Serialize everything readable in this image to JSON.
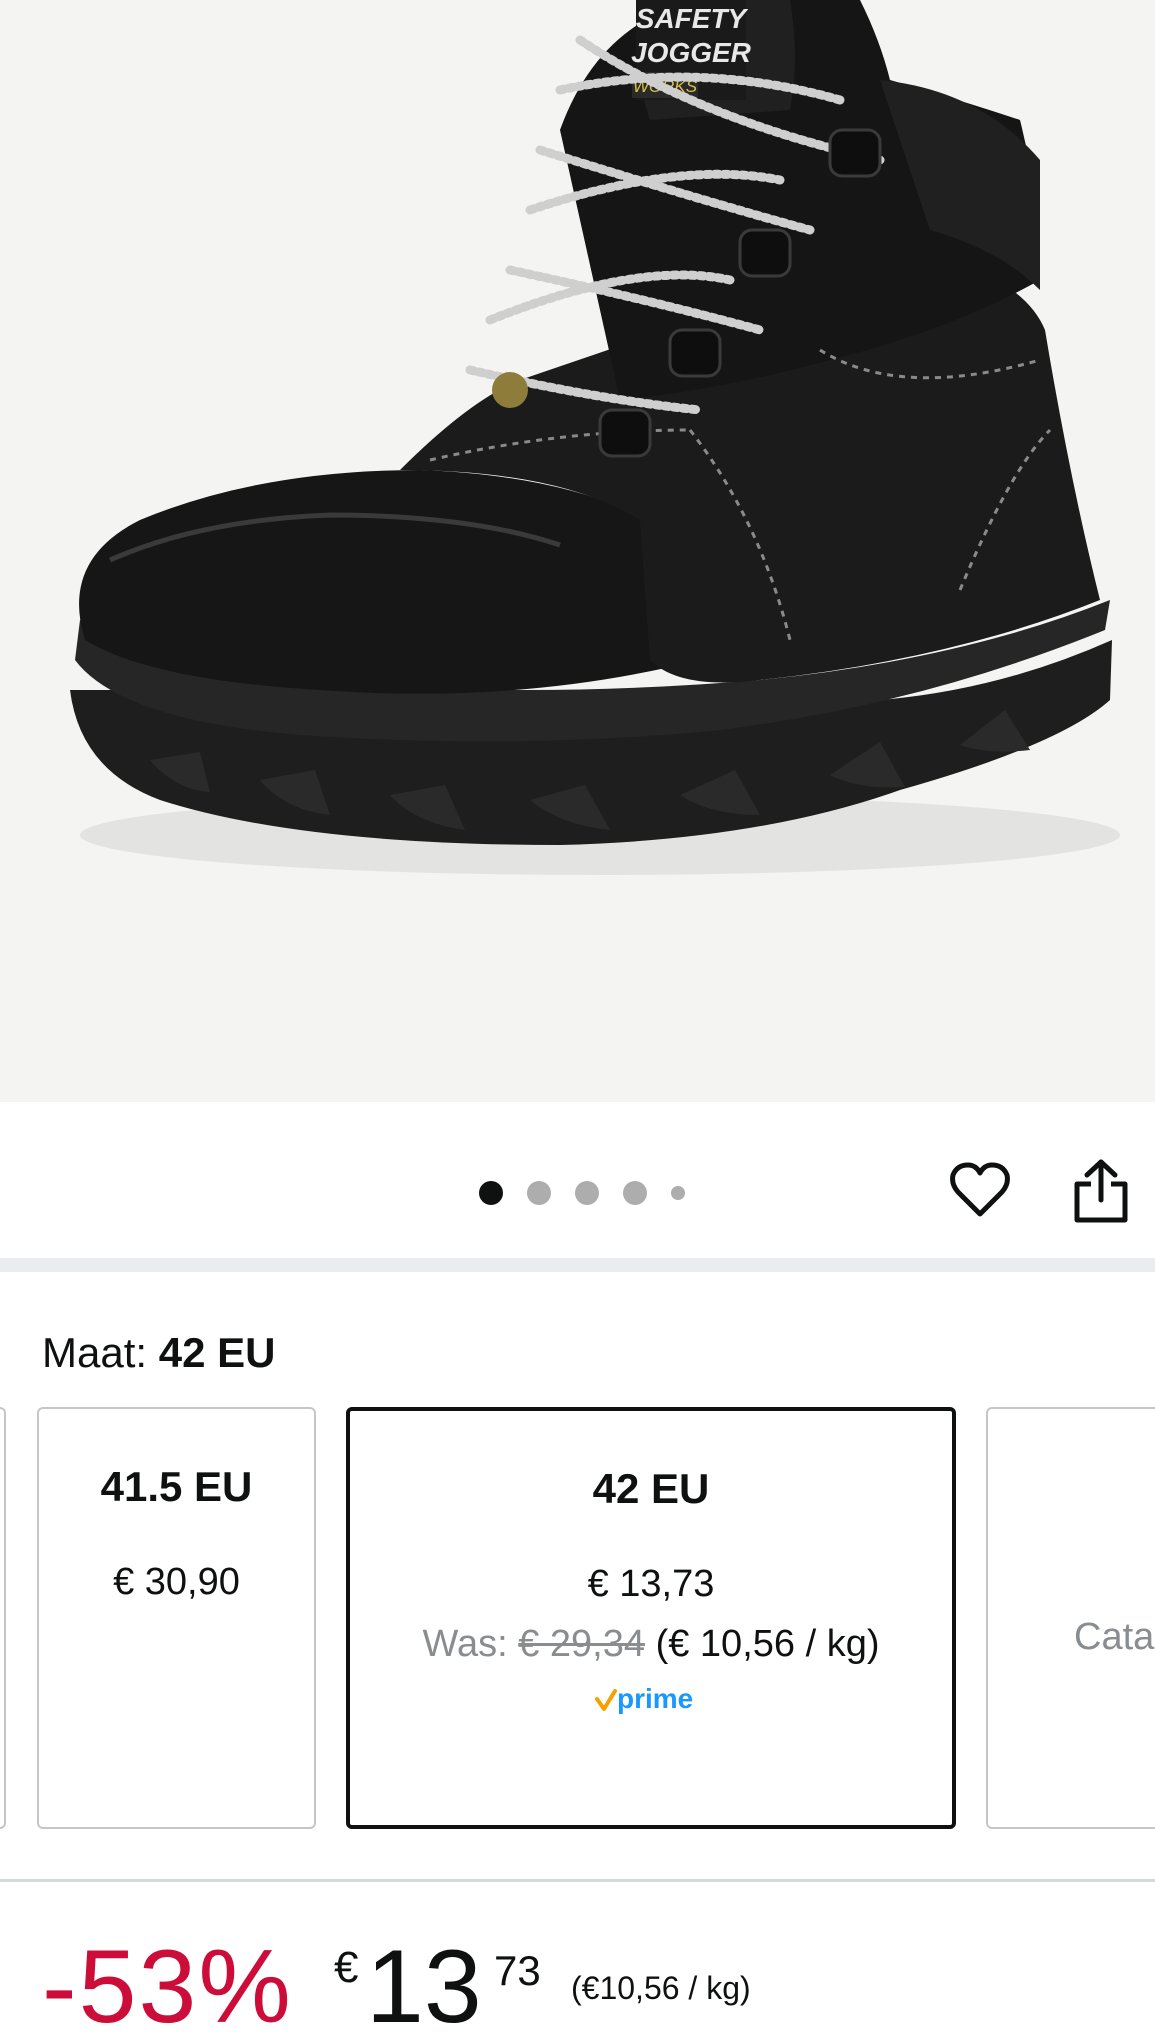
{
  "product_image": {
    "brand_text_line1": "SAFETY",
    "brand_text_line2": "JOGGER",
    "brand_text_line3": "WORKS"
  },
  "carousel": {
    "dot_count": 5,
    "active_index": 0
  },
  "actions": {
    "wishlist_icon": "heart-outline-icon",
    "share_icon": "share-icon"
  },
  "size_selector": {
    "label": "Maat:",
    "selected_value": "42 EU",
    "options": [
      {
        "size": "41.5 EU",
        "price": "€ 30,90"
      },
      {
        "size": "42 EU",
        "price": "€ 13,73",
        "was_label": "Was:",
        "was_price": "€ 29,34",
        "unit_price": "(€ 10,56 / kg)",
        "badge": "prime"
      },
      {
        "size": "",
        "price": "",
        "status": "Cata"
      }
    ]
  },
  "price": {
    "discount": "-53%",
    "currency": "€",
    "whole": "13",
    "fraction": "73",
    "unit_price": "(€10,56 / kg)"
  },
  "colors": {
    "discount": "#cc0c39",
    "prime_blue": "#1a98ff",
    "prime_check": "#f7a100"
  }
}
